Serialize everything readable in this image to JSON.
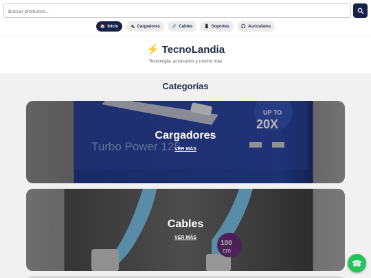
{
  "search": {
    "placeholder": "Buscar productos..."
  },
  "nav": [
    {
      "icon": "home-icon",
      "glyph": "🏠",
      "label": "Inicio",
      "active": true
    },
    {
      "icon": "plug-icon",
      "glyph": "🔌",
      "label": "Cargadores",
      "active": false
    },
    {
      "icon": "link-icon",
      "glyph": "🔗",
      "label": "Cables",
      "active": false
    },
    {
      "icon": "phone-icon",
      "glyph": "📱",
      "label": "Soportes",
      "active": false
    },
    {
      "icon": "headphones-icon",
      "glyph": "🎧",
      "label": "Auriculares",
      "active": false
    }
  ],
  "brand": {
    "title": "TecnoLandia",
    "subtitle": "Tecnología, accesorios y mucho más"
  },
  "categories": {
    "title": "Categorías",
    "items": [
      {
        "title": "Cargadores",
        "link": "VER MÁS"
      },
      {
        "title": "Cables",
        "link": "VER MÁS"
      }
    ]
  },
  "colors": {
    "primary": "#16224a",
    "whatsapp": "#25c35a",
    "accent": "#f2b705"
  }
}
